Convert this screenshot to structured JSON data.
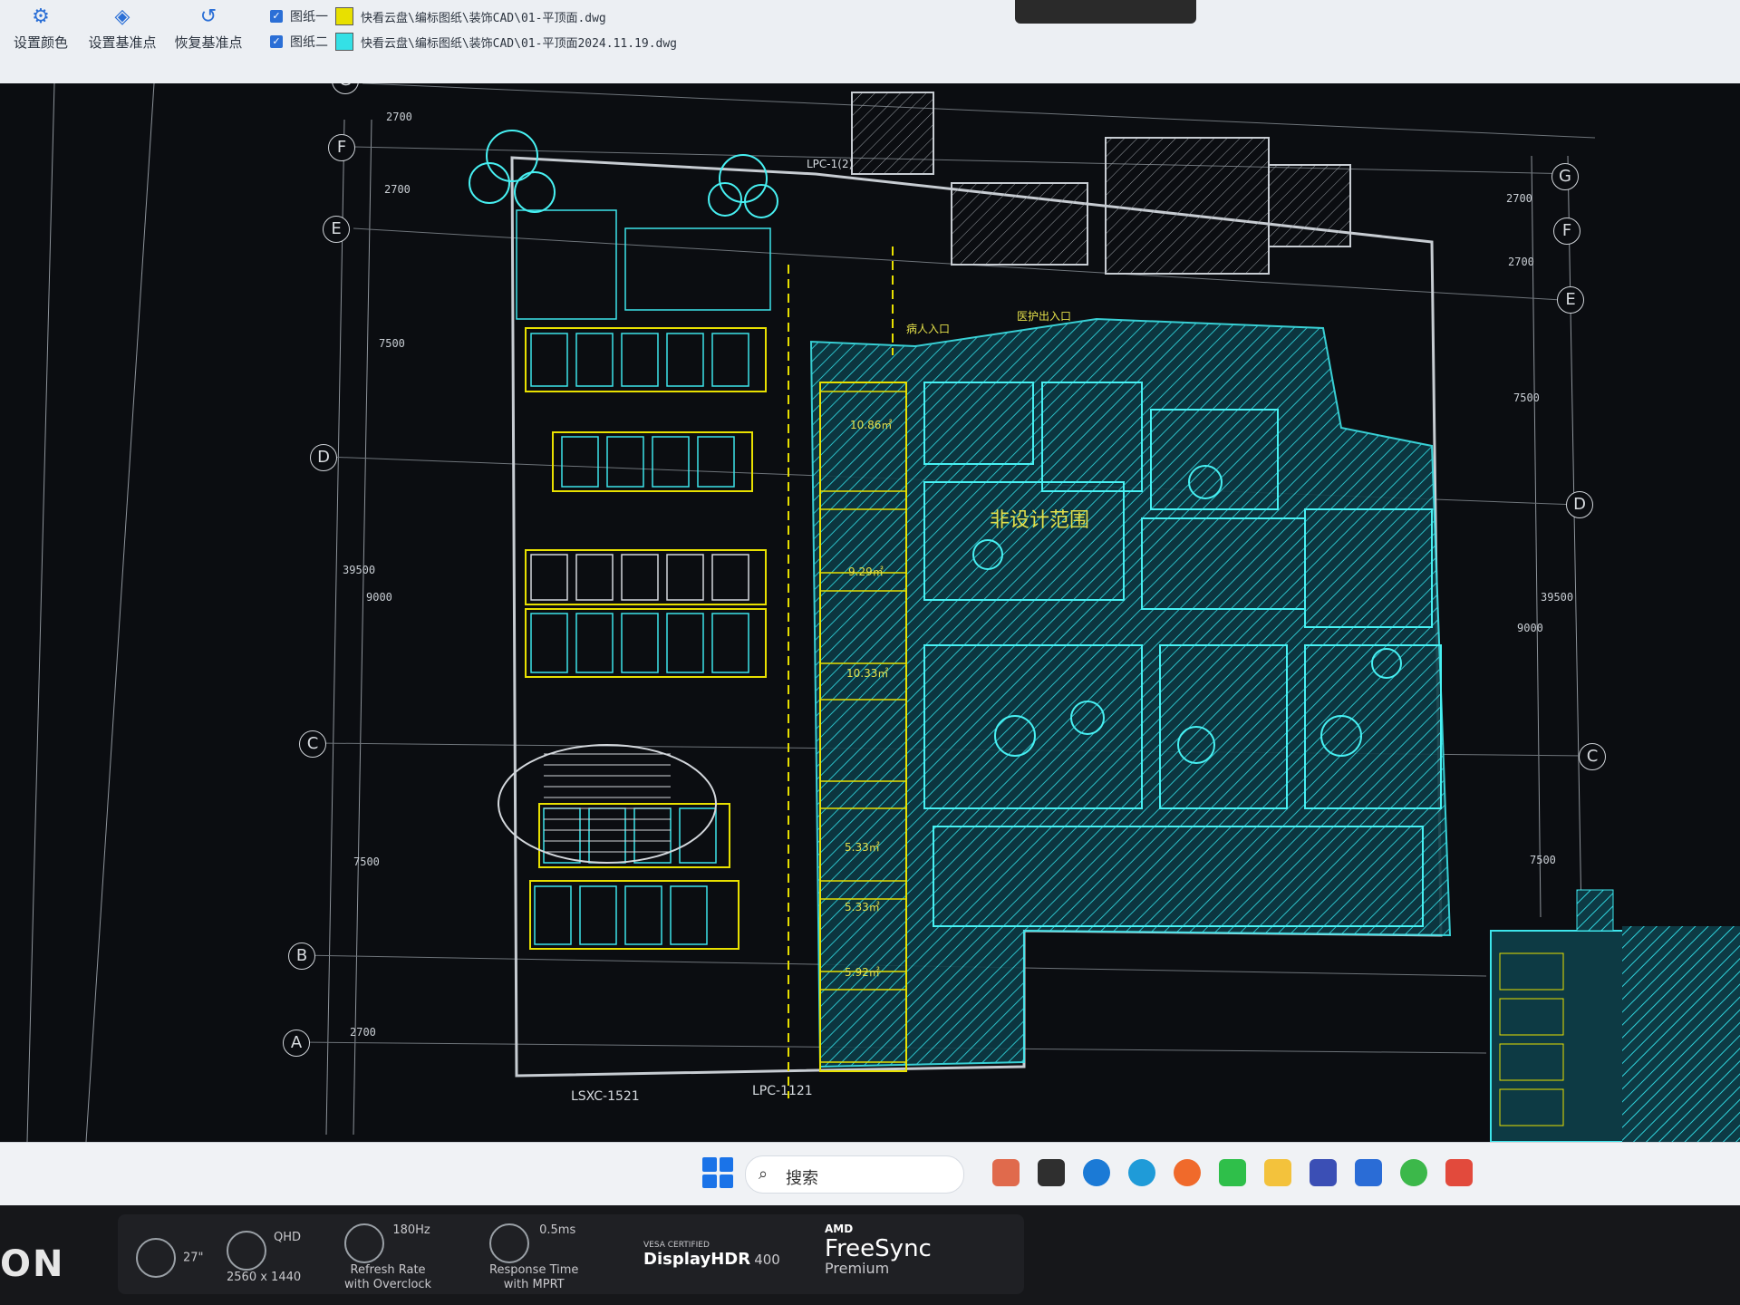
{
  "toolbar": {
    "set_color": "设置颜色",
    "set_base": "设置基准点",
    "restore_base": "恢复基准点",
    "layers": [
      {
        "name": "图纸一",
        "color": "#e8e000",
        "path": "快看云盘\\编标图纸\\装饰CAD\\01-平顶面.dwg",
        "checked": true
      },
      {
        "name": "图纸二",
        "color": "#34e0e6",
        "path": "快看云盘\\编标图纸\\装饰CAD\\01-平顶面2024.11.19.dwg",
        "checked": true
      }
    ]
  },
  "drawing": {
    "grid_left": [
      "G",
      "F",
      "E",
      "D",
      "C",
      "B",
      "A"
    ],
    "grid_right": [
      "G",
      "F",
      "E",
      "D",
      "C"
    ],
    "dims_left": [
      "2700",
      "2700",
      "7500",
      "39500",
      "9000",
      "7500",
      "2700"
    ],
    "dims_right": [
      "2700",
      "2700",
      "7500",
      "39500",
      "9000",
      "7500"
    ],
    "labels": {
      "lpc_top": "LPC-1(2)",
      "lsxc_bottom": "LSXC-1521",
      "lpc_bottom": "LPC-1121",
      "area1": "10.86㎡",
      "area2": "9.29㎡",
      "area3": "10.33㎡",
      "area4": "5.33㎡",
      "area5": "5.33㎡",
      "area6": "5.92㎡",
      "entry1": "病人入口",
      "entry2": "医护出入口",
      "room": "非设计范围"
    }
  },
  "taskbar": {
    "search_placeholder": "搜索"
  },
  "monitor": {
    "brand": "ON",
    "size": "27\"",
    "res_title": "QHD",
    "res": "2560 x 1440",
    "refresh": "180Hz",
    "refresh_sub1": "Refresh Rate",
    "refresh_sub2": "with Overclock",
    "resp": "0.5ms",
    "resp_sub1": "Response Time",
    "resp_sub2": "with MPRT",
    "hdr_top": "VESA CERTIFIED",
    "hdr": "DisplayHDR",
    "hdr_num": "400",
    "amd": "AMD",
    "freesync": "FreeSync",
    "premium": "Premium"
  }
}
